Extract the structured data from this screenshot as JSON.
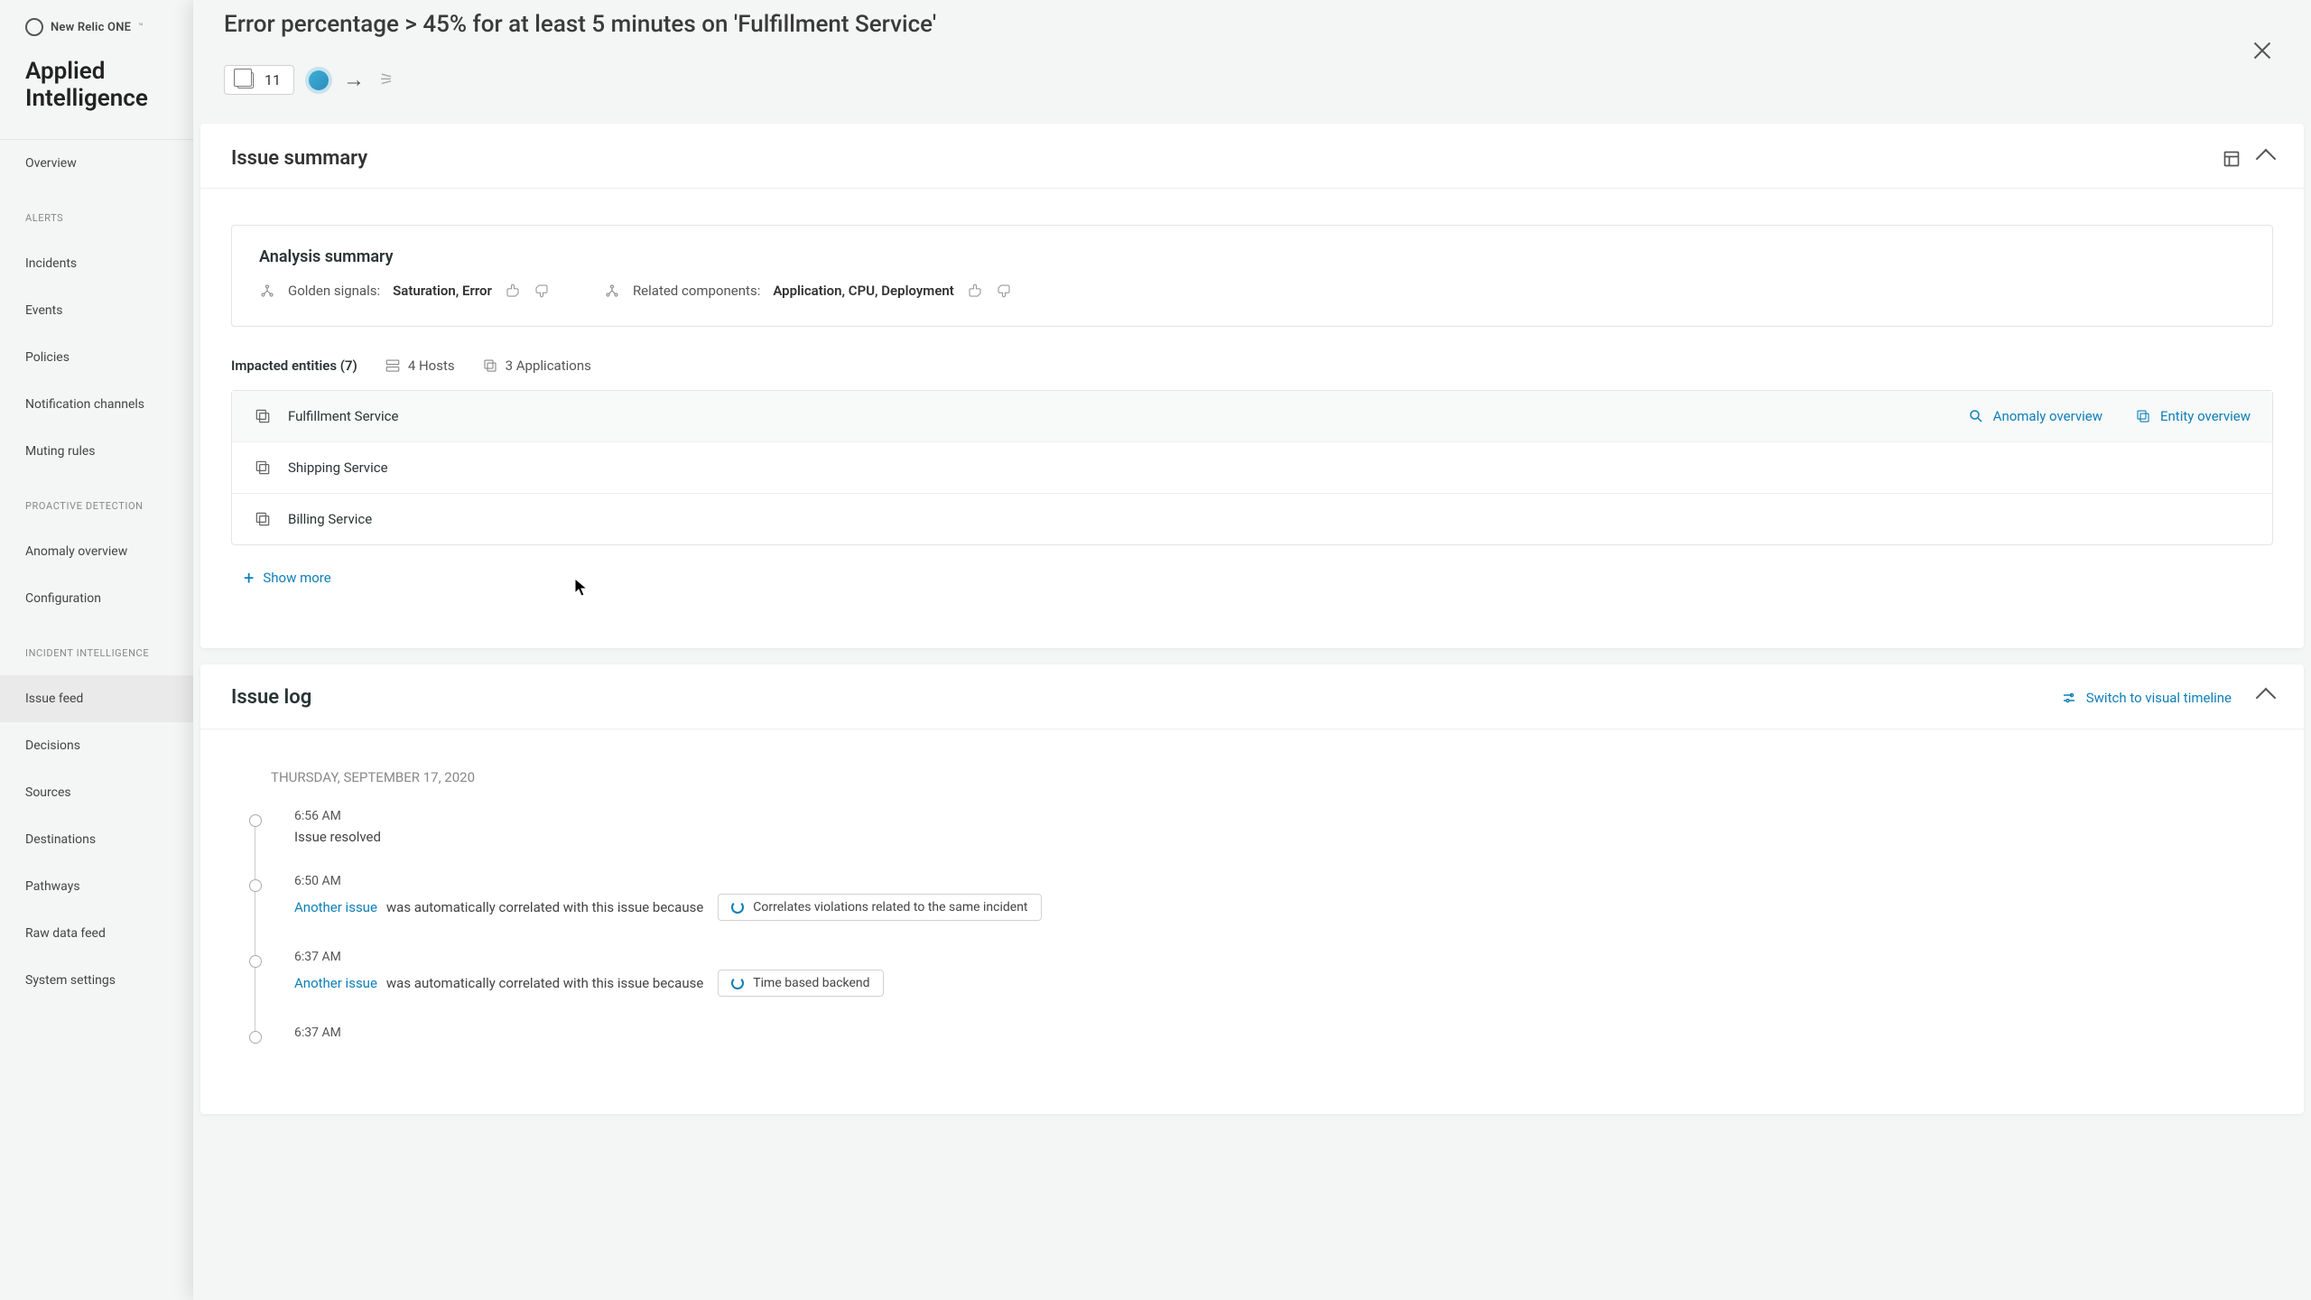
{
  "brand": {
    "name": "New Relic ONE",
    "tm": "™"
  },
  "appTitle": "Applied Intelligence",
  "nav": {
    "overview": "Overview",
    "alerts_head": "ALERTS",
    "incidents": "Incidents",
    "events": "Events",
    "policies": "Policies",
    "notif": "Notification channels",
    "muting": "Muting rules",
    "proactive_head": "PROACTIVE DETECTION",
    "anomaly": "Anomaly overview",
    "config": "Configuration",
    "incident_head": "INCIDENT INTELLIGENCE",
    "issue_feed": "Issue feed",
    "decisions": "Decisions",
    "sources": "Sources",
    "destinations": "Destinations",
    "pathways": "Pathways",
    "raw": "Raw data feed",
    "sys": "System settings"
  },
  "overlay": {
    "title": "Error percentage > 45% for at least 5 minutes on 'Fulfillment Service'",
    "badge": "11"
  },
  "summary": {
    "title": "Issue summary",
    "analysis_title": "Analysis summary",
    "golden_label": "Golden signals:",
    "golden_val": "Saturation, Error",
    "related_label": "Related components:",
    "related_val": "Application, CPU, Deployment",
    "impacted_label": "Impacted entities (7)",
    "hosts": "4 Hosts",
    "apps": "3 Applications",
    "entities": [
      {
        "name": "Fulfillment Service"
      },
      {
        "name": "Shipping Service"
      },
      {
        "name": "Billing Service"
      }
    ],
    "anomaly_link": "Anomaly overview",
    "entity_link": "Entity overview",
    "show_more": "Show more"
  },
  "log": {
    "title": "Issue log",
    "switch": "Switch to visual timeline",
    "date": "THURSDAY, SEPTEMBER 17, 2020",
    "items": [
      {
        "time": "6:56 AM",
        "text": "Issue resolved"
      },
      {
        "time": "6:50 AM",
        "link": "Another issue",
        "text": " was automatically correlated with this issue because",
        "tag": "Correlates violations related to the same incident"
      },
      {
        "time": "6:37 AM",
        "link": "Another issue",
        "text": " was automatically correlated with this issue because",
        "tag": "Time based backend"
      },
      {
        "time": "6:37 AM",
        "text": ""
      }
    ]
  }
}
